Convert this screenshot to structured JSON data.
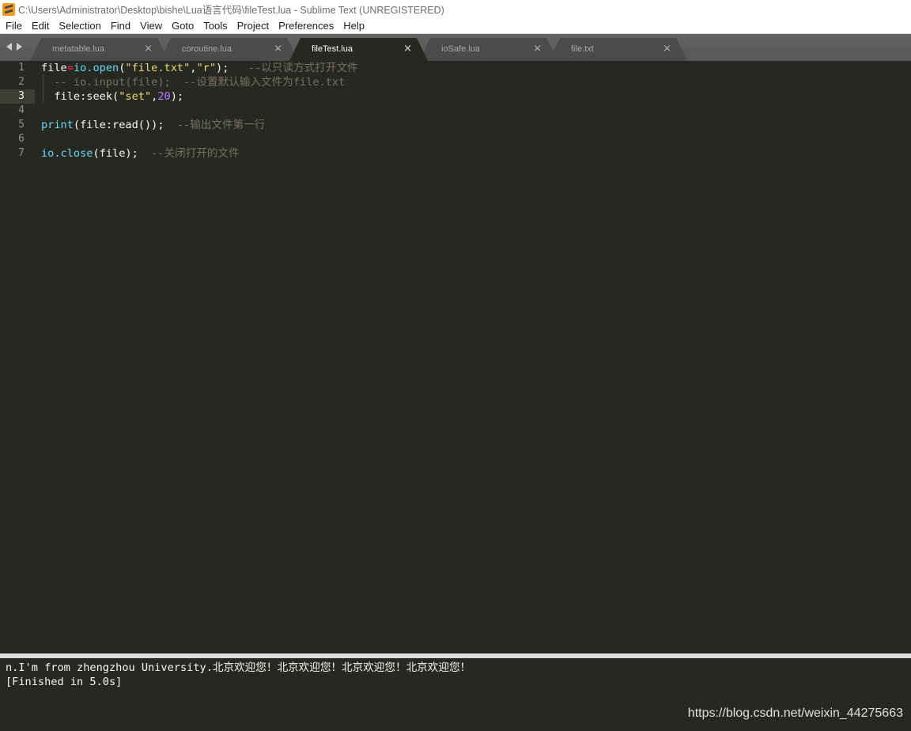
{
  "window": {
    "title": "C:\\Users\\Administrator\\Desktop\\bishe\\Lua语言代码\\fileTest.lua - Sublime Text (UNREGISTERED)",
    "icon": "sublime-text-logo-icon"
  },
  "menu": [
    "File",
    "Edit",
    "Selection",
    "Find",
    "View",
    "Goto",
    "Tools",
    "Project",
    "Preferences",
    "Help"
  ],
  "tabs": [
    {
      "label": "metatable.lua",
      "active": false
    },
    {
      "label": "coroutine.lua",
      "active": false
    },
    {
      "label": "fileTest.lua",
      "active": true
    },
    {
      "label": "ioSafe.lua",
      "active": false
    },
    {
      "label": "file.txt",
      "active": false
    }
  ],
  "tab_close_glyph": "×",
  "editor": {
    "line_numbers": [
      "1",
      "2",
      "3",
      "4",
      "5",
      "6",
      "7"
    ],
    "current_line": "3",
    "lines": [
      {
        "tokens": [
          {
            "t": "file",
            "c": "var"
          },
          {
            "t": "=",
            "c": "op"
          },
          {
            "t": "io.open",
            "c": "fn"
          },
          {
            "t": "(",
            "c": "var"
          },
          {
            "t": "\"file.txt\"",
            "c": "str"
          },
          {
            "t": ",",
            "c": "var"
          },
          {
            "t": "\"r\"",
            "c": "str"
          },
          {
            "t": ");   ",
            "c": "var"
          },
          {
            "t": "--以只读方式打开文件",
            "c": "cmt"
          }
        ]
      },
      {
        "tokens": [
          {
            "t": "  -- io.input(file);  --设置默认输入文件为file.txt",
            "c": "cmt"
          }
        ]
      },
      {
        "tokens": [
          {
            "t": "  file:seek(",
            "c": "var"
          },
          {
            "t": "\"set\"",
            "c": "str"
          },
          {
            "t": ",",
            "c": "var"
          },
          {
            "t": "20",
            "c": "num"
          },
          {
            "t": ");",
            "c": "var"
          }
        ]
      },
      {
        "tokens": []
      },
      {
        "tokens": [
          {
            "t": "print",
            "c": "fn"
          },
          {
            "t": "(file:read());  ",
            "c": "var"
          },
          {
            "t": "--输出文件第一行",
            "c": "cmt"
          }
        ]
      },
      {
        "tokens": []
      },
      {
        "tokens": [
          {
            "t": "io.close",
            "c": "fn"
          },
          {
            "t": "(file);  ",
            "c": "var"
          },
          {
            "t": "--关闭打开的文件",
            "c": "cmt"
          }
        ]
      }
    ]
  },
  "output": {
    "lines": [
      "n.I'm from zhengzhou University.北京欢迎您！北京欢迎您！北京欢迎您！北京欢迎您！",
      "[Finished in 5.0s]"
    ]
  },
  "watermark": "https://blog.csdn.net/weixin_44275663",
  "colors": {
    "background": "#272822",
    "keyword": "#f92672",
    "function": "#66d9ef",
    "string": "#e6db74",
    "number": "#ae81ff",
    "comment": "#75715e"
  }
}
